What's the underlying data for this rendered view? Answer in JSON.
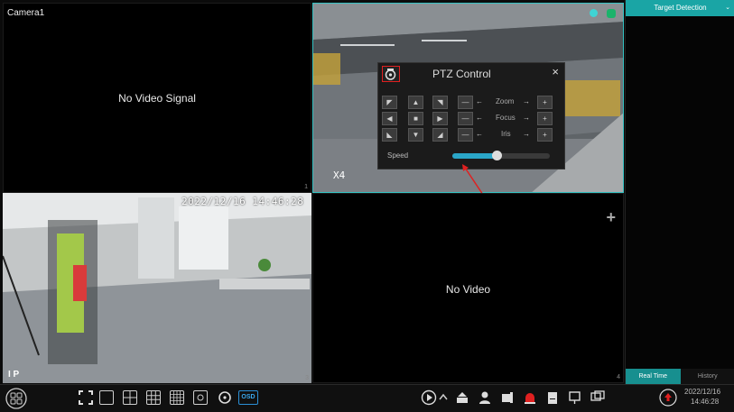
{
  "cells": [
    {
      "name": "Camera1",
      "text": "No Video Signal",
      "num": "1"
    },
    {
      "name": "",
      "text": "",
      "num": "",
      "osd_x": "X4"
    },
    {
      "name": "",
      "text": "",
      "num": "3",
      "timestamp": "2022/12/16 14:46:28",
      "overlay": "I P"
    },
    {
      "name": "",
      "text": "No Video",
      "num": "4",
      "plus": "+"
    }
  ],
  "ptz": {
    "title": "PTZ Control",
    "close": "×",
    "labels": {
      "zoom": "Zoom",
      "focus": "Focus",
      "iris": "Iris"
    },
    "speed_label": "Speed",
    "speed_value": 0.45,
    "minus": "—",
    "plus": "+",
    "left_arrow": "←",
    "right_arrow": "→"
  },
  "panel": {
    "header": "Target Detection",
    "chevron": "⌄",
    "tabs": [
      "Real Time",
      "History"
    ]
  },
  "bottombar": {
    "osd_label": "OSD",
    "date": "2022/12/16",
    "time": "14:46:28"
  },
  "colors": {
    "accent": "#1aa5a5",
    "highlight": "#e02020"
  }
}
